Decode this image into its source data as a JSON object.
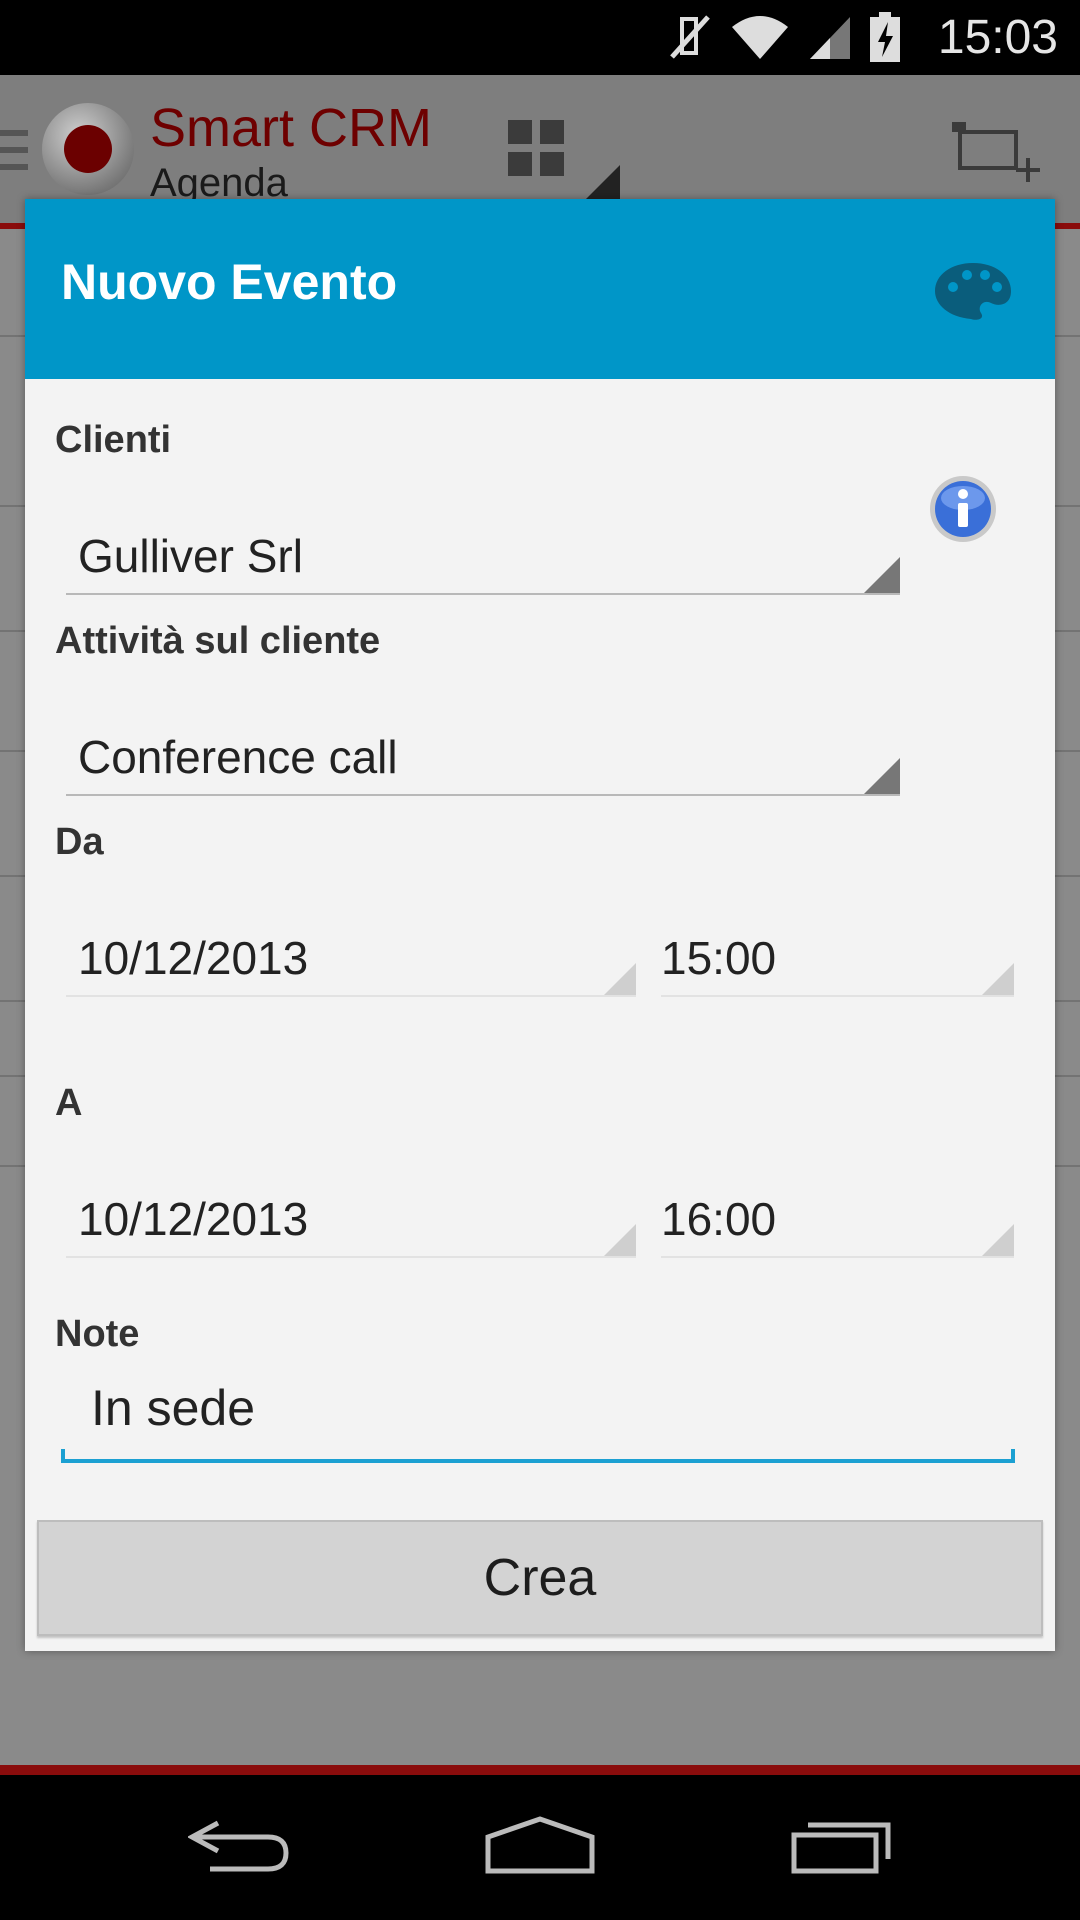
{
  "status_bar": {
    "time": "15:03"
  },
  "app_bar": {
    "title": "Smart CRM",
    "subtitle": "Agenda"
  },
  "dialog": {
    "title": "Nuovo Evento",
    "clienti": {
      "label": "Clienti",
      "value": "Gulliver Srl"
    },
    "attivita": {
      "label": "Attività  sul cliente",
      "value": "Conference call"
    },
    "da": {
      "label": "Da",
      "date": "10/12/2013",
      "time": "15:00"
    },
    "a": {
      "label": "A",
      "date": "10/12/2013",
      "time": "16:00"
    },
    "note": {
      "label": "Note",
      "value": "In sede"
    },
    "create_label": "Crea"
  },
  "colors": {
    "header": "#0096c8",
    "accent_red": "#8a0c0c",
    "input_focus": "#1ba0d2"
  },
  "icons": [
    "mute-icon",
    "wifi-icon",
    "signal-icon",
    "battery-charging-icon",
    "menu-icon",
    "vodafone-logo",
    "grid-icon",
    "add-event-icon",
    "palette-icon",
    "info-icon",
    "back-icon",
    "home-icon",
    "recents-icon"
  ]
}
